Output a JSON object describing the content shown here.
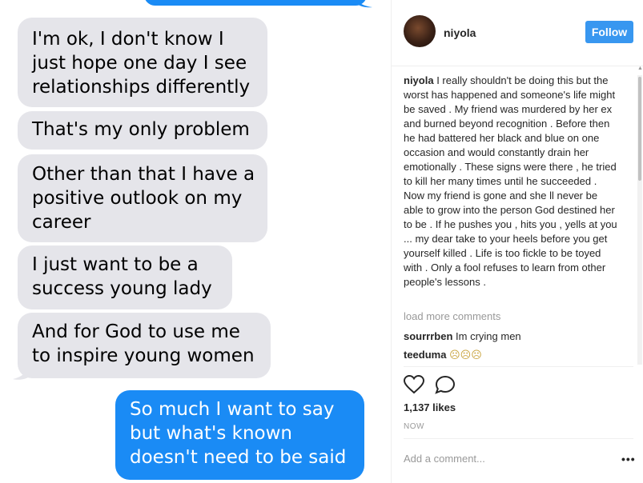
{
  "messages": {
    "m1": "I'm ok, I don't know I\njust hope one day I see\nrelationships differently",
    "m2": "That's my only problem",
    "m3": "Other than that I have a\npositive outlook on my\ncareer",
    "m4": "I just want to be a\nsuccess young lady",
    "m5": "And for God to use me\nto inspire young women",
    "m6": "So much I want to say\nbut what's known\ndoesn't need to be said"
  },
  "post": {
    "username": "niyola",
    "follow_label": "Follow",
    "caption_user": "niyola",
    "caption_text": "I really shouldn't be doing this but the worst has happened and someone's life might be saved . My friend was murdered by her ex and burned beyond recognition . Before then he had battered her black and blue on one occasion and would constantly drain her emotionally . These signs were there , he tried to kill her many times until he succeeded . Now my friend is gone and she ll never be able to grow into the person God destined her to be . If he pushes you , hits you , yells at you ... my dear take to your heels before you get yourself killed . Life is too fickle to be toyed with . Only a fool refuses to learn from other people's lessons .",
    "load_more": "load more comments",
    "comments": [
      {
        "user": "sourrrben",
        "text": "Im crying men"
      },
      {
        "user": "teeduma",
        "text": "☹☹☹"
      }
    ],
    "likes": "1,137 likes",
    "time": "NOW",
    "add_comment_placeholder": "Add a comment...",
    "more_options": "•••",
    "icons": {
      "like": "heart-icon",
      "comment": "comment-icon"
    }
  },
  "colors": {
    "incoming": "#e5e5ea",
    "outgoing": "#1a8bf5",
    "follow": "#3897f0"
  }
}
